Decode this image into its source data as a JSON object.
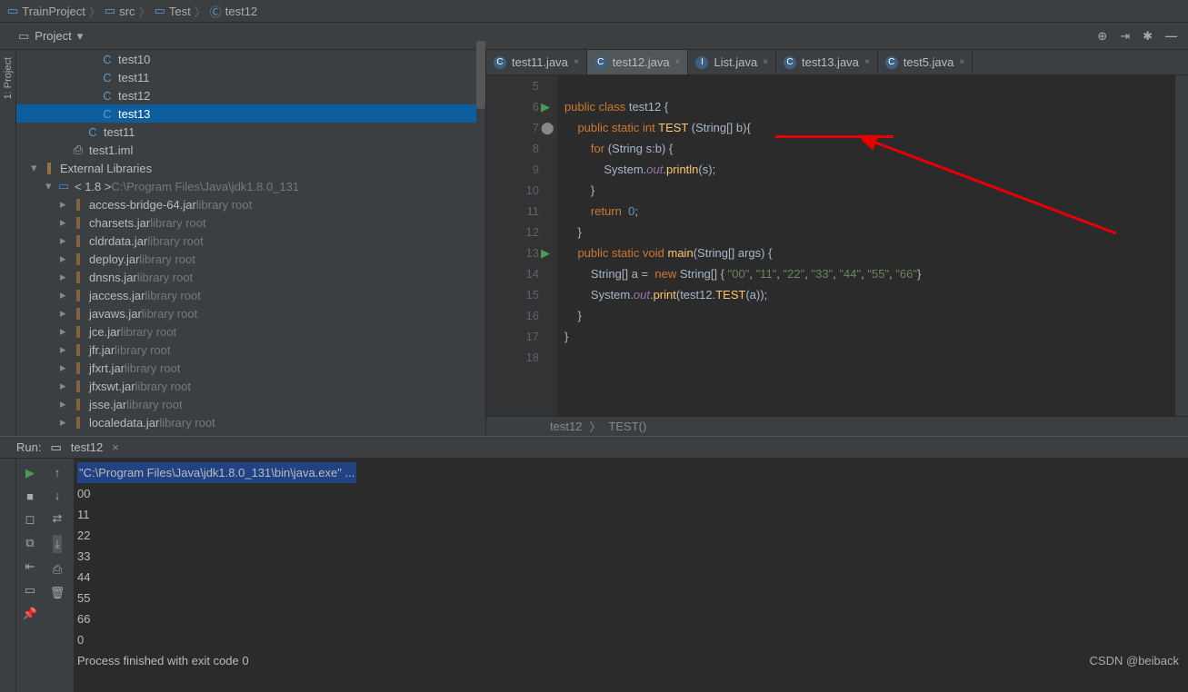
{
  "breadcrumb": [
    "TrainProject",
    "src",
    "Test",
    "test12"
  ],
  "projectLabel": "Project",
  "sidebarTab": "1: Project",
  "tree": {
    "items": [
      {
        "indent": 80,
        "icon": "C",
        "iconColor": "#5e9bce",
        "label": "test10"
      },
      {
        "indent": 80,
        "icon": "C",
        "iconColor": "#5e9bce",
        "label": "test11"
      },
      {
        "indent": 80,
        "icon": "C",
        "iconColor": "#5e9bce",
        "label": "test12"
      },
      {
        "indent": 80,
        "icon": "C",
        "iconColor": "#5e9bce",
        "label": "test13",
        "selected": true
      },
      {
        "indent": 64,
        "icon": "C",
        "iconColor": "#5e9bce",
        "label": "test11"
      },
      {
        "indent": 48,
        "icon": "⎙",
        "iconColor": "#aaa",
        "label": "test1.iml"
      },
      {
        "indent": 16,
        "arrow": "▾",
        "icon": "∥",
        "iconColor": "#f0a050",
        "label": "External Libraries"
      },
      {
        "indent": 32,
        "arrow": "▾",
        "icon": "▭",
        "iconColor": "#3b8fce",
        "label": "< 1.8 >",
        "dim": "C:\\Program Files\\Java\\jdk1.8.0_131"
      },
      {
        "indent": 48,
        "arrow": "▸",
        "icon": "∥",
        "iconColor": "#c9853e",
        "label": "access-bridge-64.jar",
        "dim": "library root"
      },
      {
        "indent": 48,
        "arrow": "▸",
        "icon": "∥",
        "iconColor": "#c9853e",
        "label": "charsets.jar",
        "dim": "library root"
      },
      {
        "indent": 48,
        "arrow": "▸",
        "icon": "∥",
        "iconColor": "#c9853e",
        "label": "cldrdata.jar",
        "dim": "library root"
      },
      {
        "indent": 48,
        "arrow": "▸",
        "icon": "∥",
        "iconColor": "#c9853e",
        "label": "deploy.jar",
        "dim": "library root"
      },
      {
        "indent": 48,
        "arrow": "▸",
        "icon": "∥",
        "iconColor": "#c9853e",
        "label": "dnsns.jar",
        "dim": "library root"
      },
      {
        "indent": 48,
        "arrow": "▸",
        "icon": "∥",
        "iconColor": "#c9853e",
        "label": "jaccess.jar",
        "dim": "library root"
      },
      {
        "indent": 48,
        "arrow": "▸",
        "icon": "∥",
        "iconColor": "#c9853e",
        "label": "javaws.jar",
        "dim": "library root"
      },
      {
        "indent": 48,
        "arrow": "▸",
        "icon": "∥",
        "iconColor": "#c9853e",
        "label": "jce.jar",
        "dim": "library root"
      },
      {
        "indent": 48,
        "arrow": "▸",
        "icon": "∥",
        "iconColor": "#c9853e",
        "label": "jfr.jar",
        "dim": "library root"
      },
      {
        "indent": 48,
        "arrow": "▸",
        "icon": "∥",
        "iconColor": "#c9853e",
        "label": "jfxrt.jar",
        "dim": "library root"
      },
      {
        "indent": 48,
        "arrow": "▸",
        "icon": "∥",
        "iconColor": "#c9853e",
        "label": "jfxswt.jar",
        "dim": "library root"
      },
      {
        "indent": 48,
        "arrow": "▸",
        "icon": "∥",
        "iconColor": "#c9853e",
        "label": "jsse.jar",
        "dim": "library root"
      },
      {
        "indent": 48,
        "arrow": "▸",
        "icon": "∥",
        "iconColor": "#c9853e",
        "label": "localedata.jar",
        "dim": "library root"
      }
    ]
  },
  "tabs": [
    {
      "icon": "C",
      "label": "test11.java"
    },
    {
      "icon": "C",
      "label": "test12.java",
      "active": true
    },
    {
      "icon": "I",
      "iconColor": "#62a362",
      "label": "List.java"
    },
    {
      "icon": "C",
      "label": "test13.java"
    },
    {
      "icon": "C",
      "label": "test5.java"
    }
  ],
  "code": {
    "start": 5,
    "lines": [
      "",
      "public class test12 {",
      "    public static int TEST (String[] b){",
      "        for (String s:b) {",
      "            System.out.println(s);",
      "        }",
      "        return  0;",
      "    }",
      "    public static void main(String[] args) {",
      "        String[] a =  new String[] { \"00\", \"11\", \"22\", \"33\", \"44\", \"55\", \"66\"}",
      "        System.out.print(test12.TEST(a));",
      "    }",
      "}",
      ""
    ],
    "runnableLines": [
      6,
      13
    ],
    "override": 7
  },
  "crumbs2": [
    "test12",
    "TEST()"
  ],
  "run": {
    "title": "Run:",
    "config": "test12",
    "cmd": "\"C:\\Program Files\\Java\\jdk1.8.0_131\\bin\\java.exe\" ...",
    "output": [
      "00",
      "11",
      "22",
      "33",
      "44",
      "55",
      "66",
      "0",
      "Process finished with exit code 0"
    ]
  },
  "watermark": "CSDN @beiback"
}
